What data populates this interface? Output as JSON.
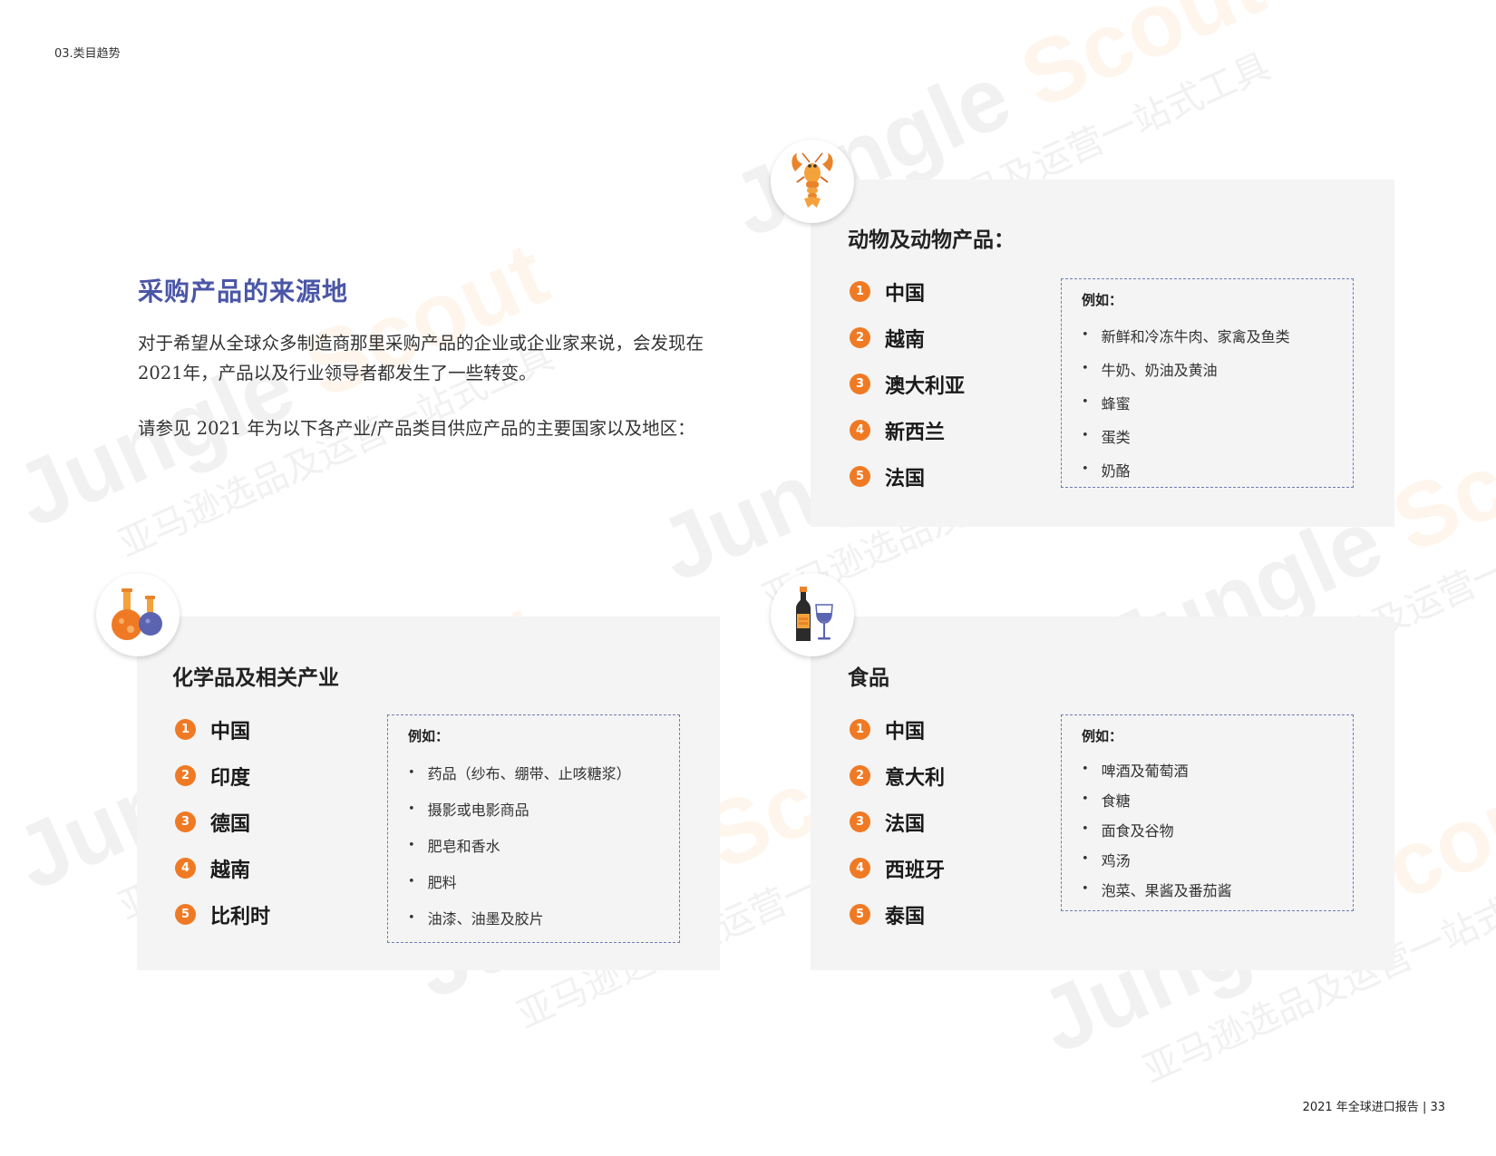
{
  "header": {
    "section": "03.类目趋势"
  },
  "footer": {
    "page_label": "2021 年全球进口报告 | 33"
  },
  "intro": {
    "title": "采购产品的来源地",
    "paragraph_1": "对于希望从全球众多制造商那里采购产品的企业或企业家来说，会发现在2021年，产品以及行业领导者都发生了一些转变。",
    "paragraph_2": "请参见 2021 年为以下各产业/产品类目供应产品的主要国家以及地区："
  },
  "watermark": {
    "brand_1": "Jungle",
    "brand_2": "Scout",
    "tagline": "亚马逊选品及运营一站式工具"
  },
  "panels": {
    "animal": {
      "icon": "lobster-icon",
      "title": "动物及动物产品：",
      "countries": [
        {
          "rank": "1",
          "name": "中国"
        },
        {
          "rank": "2",
          "name": "越南"
        },
        {
          "rank": "3",
          "name": "澳大利亚"
        },
        {
          "rank": "4",
          "name": "新西兰"
        },
        {
          "rank": "5",
          "name": "法国"
        }
      ],
      "examples_heading": "例如：",
      "examples": [
        "新鲜和冷冻牛肉、家禽及鱼类",
        "牛奶、奶油及黄油",
        "蜂蜜",
        "蛋类",
        "奶酪"
      ]
    },
    "chemical": {
      "icon": "flask-icon",
      "title": "化学品及相关产业",
      "countries": [
        {
          "rank": "1",
          "name": "中国"
        },
        {
          "rank": "2",
          "name": "印度"
        },
        {
          "rank": "3",
          "name": "德国"
        },
        {
          "rank": "4",
          "name": "越南"
        },
        {
          "rank": "5",
          "name": "比利时"
        }
      ],
      "examples_heading": "例如：",
      "examples": [
        "药品（纱布、绷带、止咳糖浆）",
        "摄影或电影商品",
        "肥皂和香水",
        "肥料",
        "油漆、油墨及胶片"
      ]
    },
    "food": {
      "icon": "wine-icon",
      "title": "食品",
      "countries": [
        {
          "rank": "1",
          "name": "中国"
        },
        {
          "rank": "2",
          "name": "意大利"
        },
        {
          "rank": "3",
          "name": "法国"
        },
        {
          "rank": "4",
          "name": "西班牙"
        },
        {
          "rank": "5",
          "name": "泰国"
        }
      ],
      "examples_heading": "例如：",
      "examples": [
        "啤酒及葡萄酒",
        "食糖",
        "面食及谷物",
        "鸡汤",
        "泡菜、果酱及番茄酱"
      ]
    }
  },
  "colors": {
    "accent_orange": "#f07a24",
    "title_blue": "#4a56a6",
    "panel_bg": "#f4f4f4",
    "dash_border": "#6f7bb8"
  }
}
